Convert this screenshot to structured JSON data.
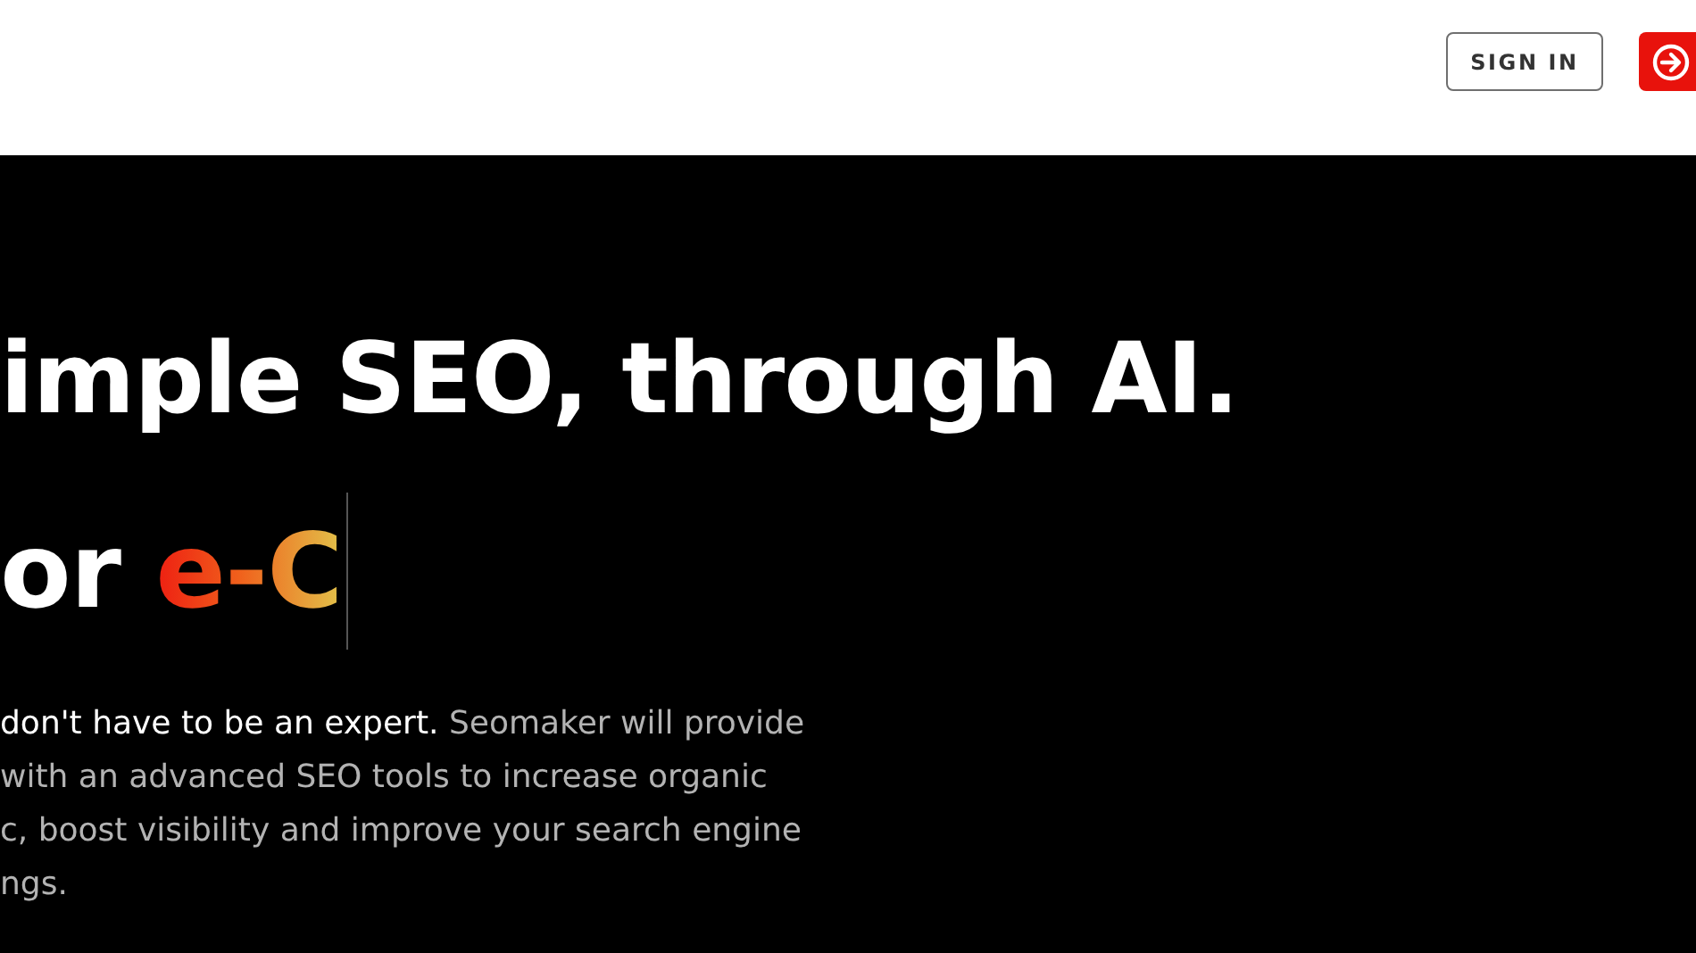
{
  "header": {
    "sign_in": "SIGN IN"
  },
  "hero": {
    "headline": "imple SEO, through AI.",
    "typed_prefix": "or ",
    "typed_word": "e-C",
    "cursor_visible": true,
    "description_lines": [
      "**don't have to be an expert.** Seomaker will provide",
      "with an advanced SEO tools to increase organic",
      "c, boost visibility and improve your search engine",
      "ngs."
    ]
  }
}
